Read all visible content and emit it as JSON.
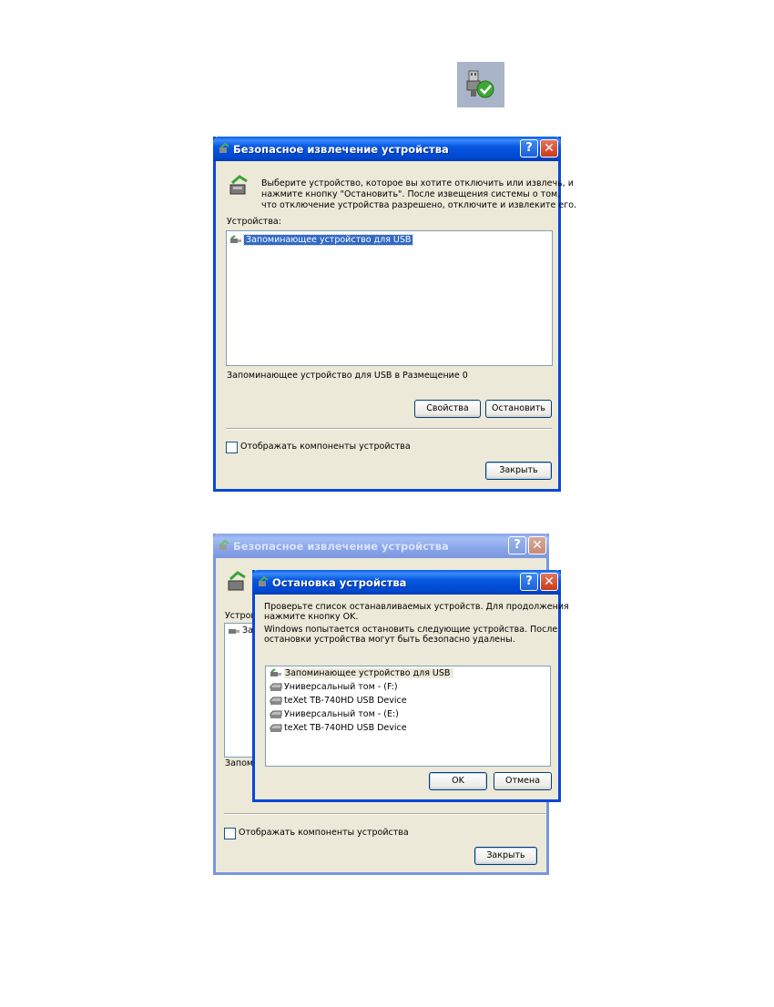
{
  "dialog1": {
    "title": "Безопасное извлечение устройства",
    "instructions": [
      "Выберите устройство, которое вы хотите отключить или извлечь, и",
      "нажмите кнопку \"Остановить\". После извещения системы о том,",
      "что отключение устройства разрешено, отключите и извлеките его."
    ],
    "devices_label": "Устройства:",
    "devices": [
      {
        "label": "Запоминающее устройство для USB",
        "icon": "usb-device-icon",
        "selected": true
      }
    ],
    "status": "Запоминающее устройство для USB в Размещение 0",
    "properties_button": "Свойства",
    "stop_button": "Остановить",
    "show_components_label": "Отображать компоненты устройства",
    "show_components_checked": false,
    "close_button": "Закрыть",
    "help_button": "?",
    "close_x": "✕"
  },
  "dialog2_bg": {
    "title": "Безопасное извлечение устройства",
    "devices_label_partial": "Устрой",
    "device_partial": "За",
    "status_partial": "Запоми",
    "show_components_label": "Отображать компоненты устройства",
    "close_button": "Закрыть",
    "help_button": "?",
    "close_x": "✕"
  },
  "dialog3": {
    "title": "Остановка устройства",
    "instructions": [
      "Проверьте список останавливаемых устройств. Для продолжения",
      "нажмите кнопку OK.",
      "Windows попытается остановить следующие устройства. После",
      "остановки устройства могут быть безопасно удалены."
    ],
    "devices": [
      {
        "label": "Запоминающее устройство для USB",
        "icon": "usb-device-icon"
      },
      {
        "label": "Универсальный том - (F:)",
        "icon": "drive-icon"
      },
      {
        "label": "teXet TB-740HD USB Device",
        "icon": "drive-icon"
      },
      {
        "label": "Универсальный том - (E:)",
        "icon": "drive-icon"
      },
      {
        "label": "teXet TB-740HD USB Device",
        "icon": "drive-icon"
      }
    ],
    "ok_button": "OK",
    "cancel_button": "Отмена",
    "help_button": "?",
    "close_x": "✕"
  },
  "colors": {
    "titlebar_active": "#0054e3",
    "titlebar_inactive": "#8aa5ea",
    "dialog_bg": "#ece9d8",
    "selection": "#316ac5",
    "tray_bg": "#a9b4c9"
  }
}
